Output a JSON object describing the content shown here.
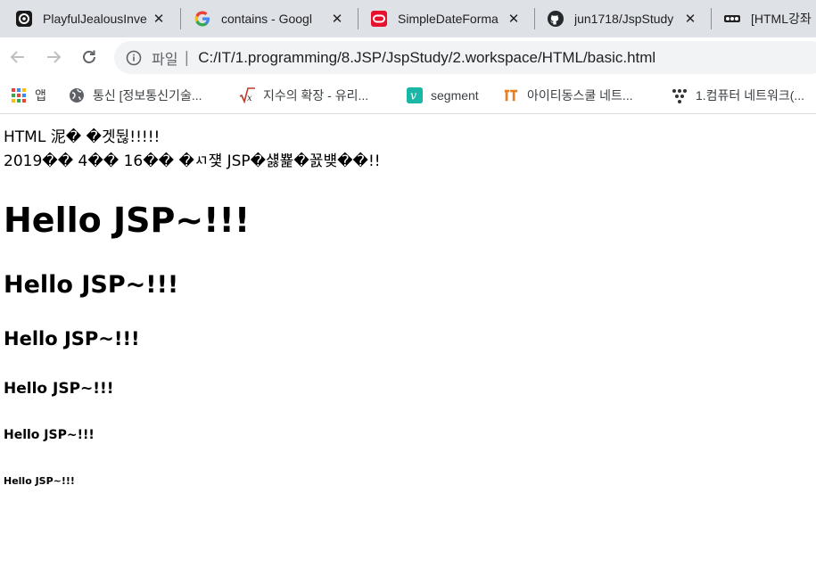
{
  "browser": {
    "tabs": [
      {
        "title": "PlayfulJealousInve",
        "icon": "replit-icon"
      },
      {
        "title": "contains - Googl",
        "icon": "google-icon"
      },
      {
        "title": "SimpleDateForma",
        "icon": "oracle-icon"
      },
      {
        "title": "jun1718/JspStudy",
        "icon": "github-icon"
      },
      {
        "title": "[HTML강좌",
        "icon": "goop-icon"
      }
    ],
    "omnibox": {
      "scheme": "파일",
      "separator": "|",
      "url": "C:/IT/1.programming/8.JSP/JspStudy/2.workspace/HTML/basic.html"
    },
    "bookmarks": [
      {
        "label": "앱",
        "icon": "apps-grid-icon"
      },
      {
        "label": "통신 [정보통신기술...",
        "icon": "globe-icon"
      },
      {
        "label": "지수의 확장 - 유리...",
        "icon": "sqrt-x-icon"
      },
      {
        "label": "segment",
        "icon": "vimeo-icon"
      },
      {
        "label": "아이티동스쿨 네트...",
        "icon": "it-logo-icon"
      },
      {
        "label": "1.컴퓨터 네트워크(...",
        "icon": "network-icon"
      }
    ]
  },
  "page": {
    "line1": "HTML 泥� �겟뒪!!!!!",
    "line2": "2019�� 4�� 16�� �ㅺ쟻 JSP�섏뾽�꾨뱾��!!",
    "h1": "Hello JSP~!!!",
    "h2": "Hello JSP~!!!",
    "h3": "Hello JSP~!!!",
    "h4": "Hello JSP~!!!",
    "h5": "Hello JSP~!!!",
    "h6": "Hello JSP~!!!"
  }
}
